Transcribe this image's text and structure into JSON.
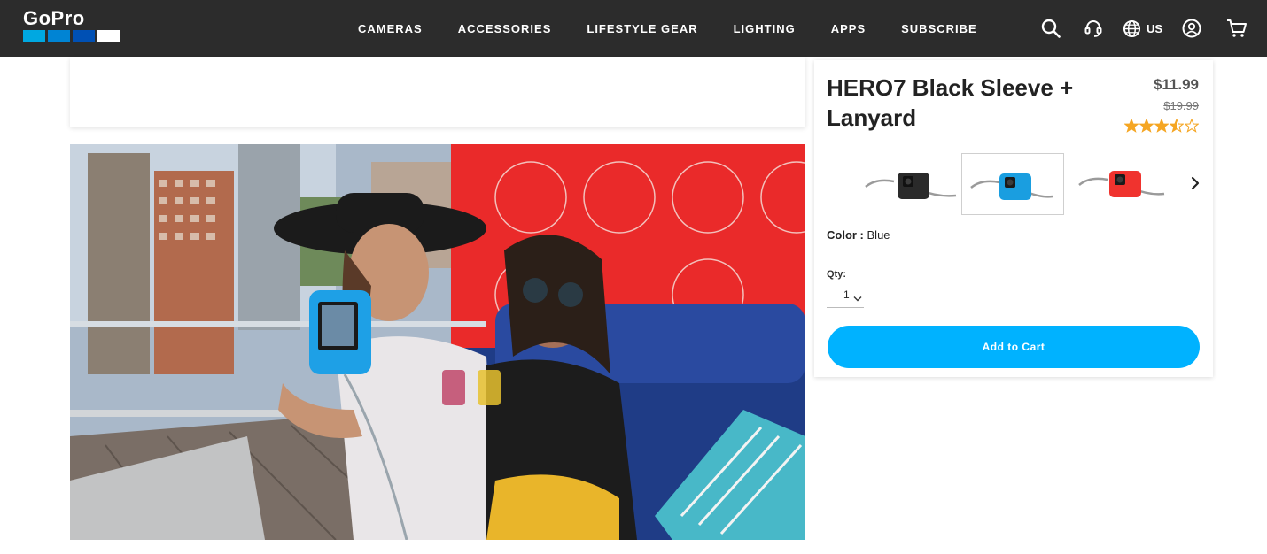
{
  "header": {
    "logo_text": "GoPro",
    "nav": [
      "CAMERAS",
      "ACCESSORIES",
      "LIFESTYLE GEAR",
      "LIGHTING",
      "APPS",
      "SUBSCRIBE"
    ],
    "region": "US",
    "icons": [
      "search-icon",
      "support-headset-icon",
      "globe-icon",
      "account-icon",
      "cart-icon"
    ]
  },
  "product": {
    "title": "HERO7 Black Sleeve + Lanyard",
    "price": "$11.99",
    "original_price": "$19.99",
    "rating": 3.5,
    "rating_max": 5,
    "swatches": [
      {
        "name": "Black",
        "color": "#2a2a2a",
        "selected": false
      },
      {
        "name": "Blue",
        "color": "#1a9ee0",
        "selected": true
      },
      {
        "name": "Red",
        "color": "#f0332e",
        "selected": false
      }
    ],
    "color_label": "Color :",
    "color_value": "Blue",
    "qty_label": "Qty:",
    "qty_value": "1",
    "add_to_cart": "Add to Cart"
  },
  "colors": {
    "header_bg": "#2c2c2c",
    "accent": "#00b2ff",
    "star": "#f5a623"
  }
}
